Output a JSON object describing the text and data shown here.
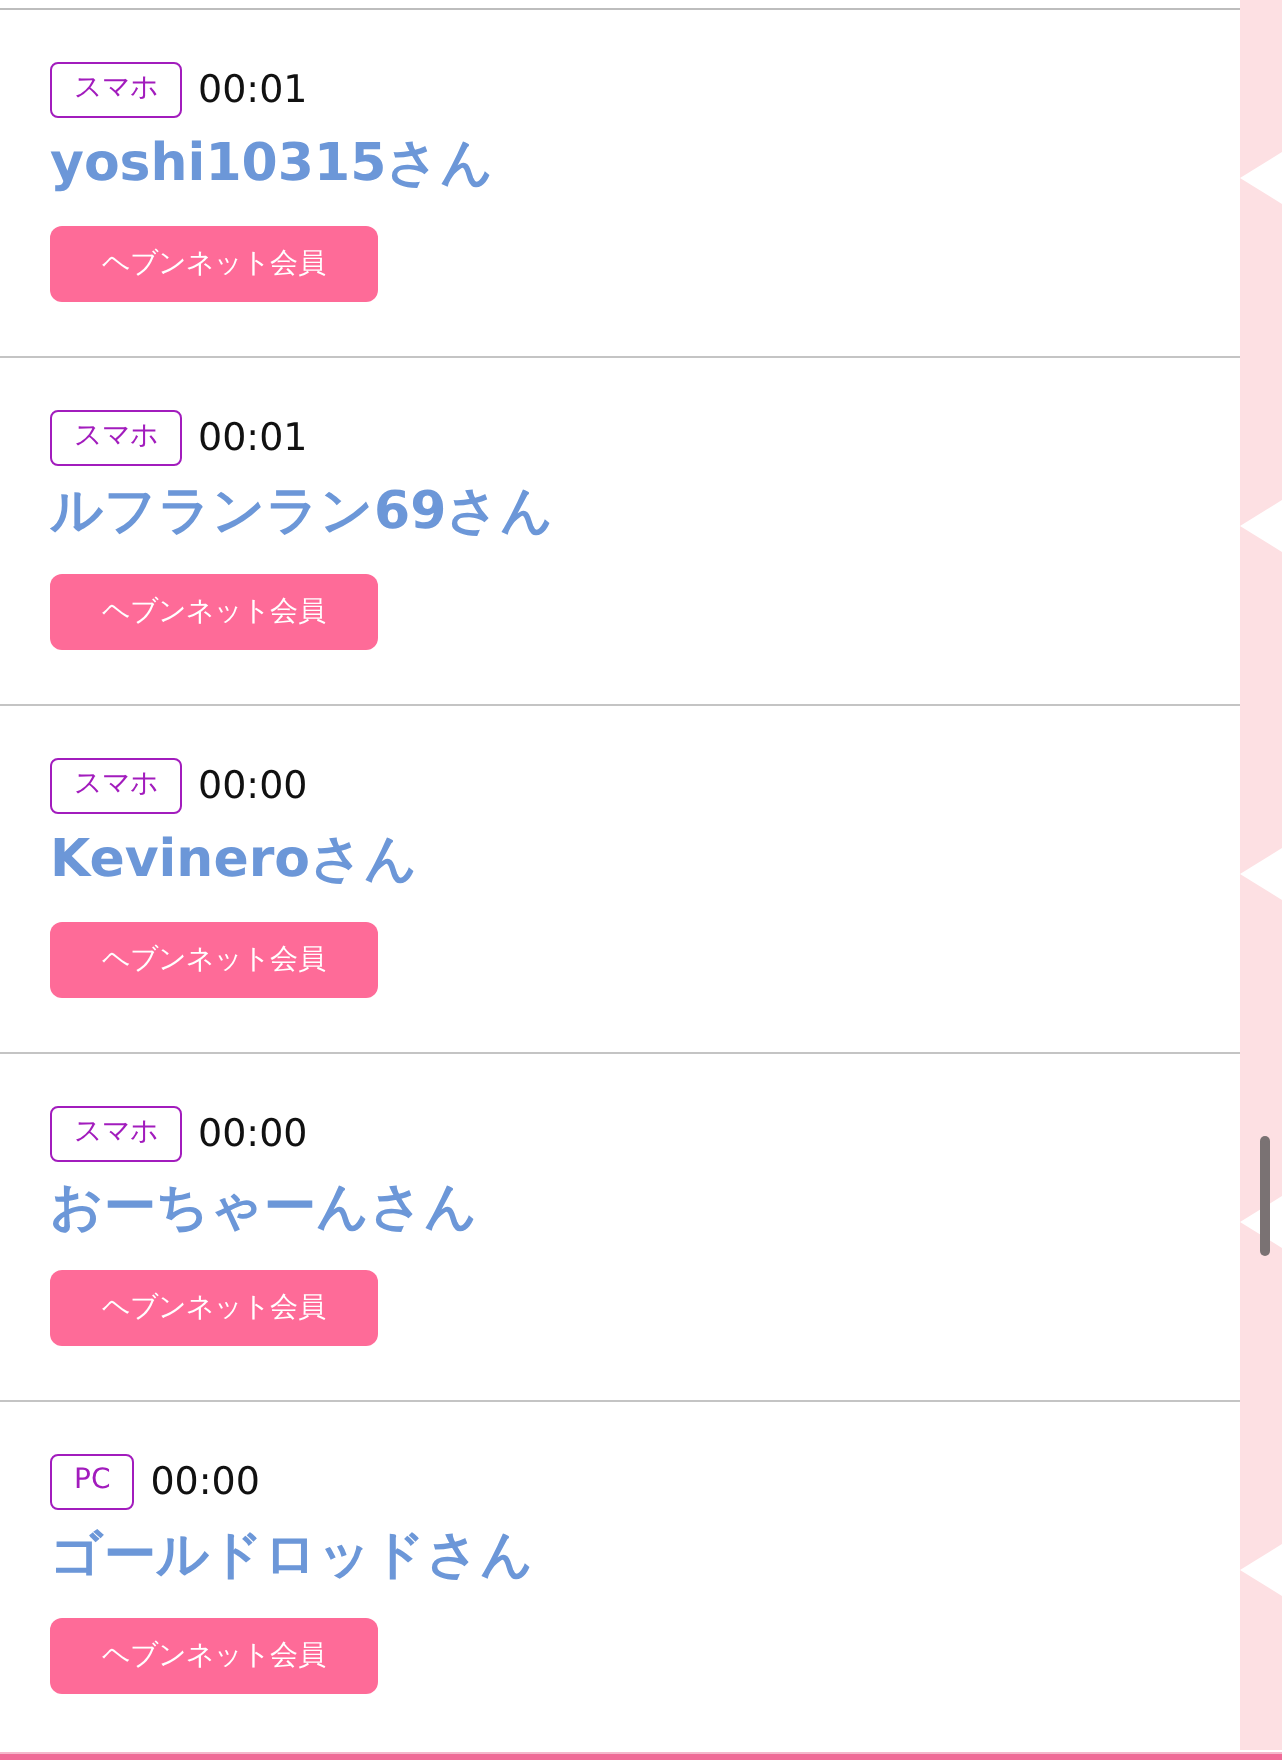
{
  "entries": [
    {
      "device": "スマホ",
      "time": "00:01",
      "name": "yoshi10315さん",
      "member_badge": "ヘブンネット会員"
    },
    {
      "device": "スマホ",
      "time": "00:01",
      "name": "ルフランラン69さん",
      "member_badge": "ヘブンネット会員"
    },
    {
      "device": "スマホ",
      "time": "00:00",
      "name": "Kevineroさん",
      "member_badge": "ヘブンネット会員"
    },
    {
      "device": "スマホ",
      "time": "00:00",
      "name": "おーちゃーんさん",
      "member_badge": "ヘブンネット会員"
    },
    {
      "device": "PC",
      "time": "00:00",
      "name": "ゴールドロッドさん",
      "member_badge": "ヘブンネット会員"
    }
  ]
}
